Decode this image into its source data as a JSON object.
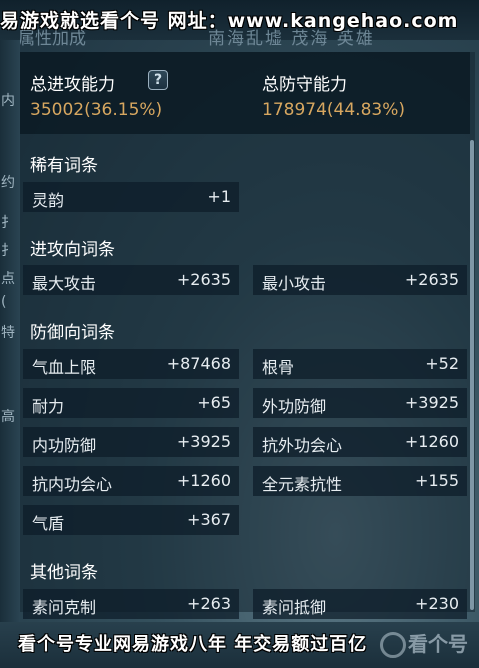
{
  "watermark_top": "易游戏就选看个号   网址：www.kangehao.com",
  "background_tabs": {
    "left": "属性加成",
    "right": "南海乱墟  茂海  英雄"
  },
  "left_strip_chars": [
    "内",
    "约",
    "扌",
    "扌",
    "点",
    "(",
    "特",
    "高"
  ],
  "summary": {
    "attack_label": "总进攻能力",
    "attack_value": "35002(36.15%)",
    "defense_label": "总防守能力",
    "defense_value": "178974(44.83%)",
    "help_icon_glyph": "?"
  },
  "sections": {
    "rare": {
      "title": "稀有词条",
      "items": [
        {
          "name": "灵韵",
          "value": "+1"
        }
      ]
    },
    "attack": {
      "title": "进攻向词条",
      "items": [
        {
          "name": "最大攻击",
          "value": "+2635"
        },
        {
          "name": "最小攻击",
          "value": "+2635"
        }
      ]
    },
    "defense": {
      "title": "防御向词条",
      "items": [
        {
          "name": "气血上限",
          "value": "+87468"
        },
        {
          "name": "根骨",
          "value": "+52"
        },
        {
          "name": "耐力",
          "value": "+65"
        },
        {
          "name": "外功防御",
          "value": "+3925"
        },
        {
          "name": "内功防御",
          "value": "+3925"
        },
        {
          "name": "抗外功会心",
          "value": "+1260"
        },
        {
          "name": "抗内功会心",
          "value": "+1260"
        },
        {
          "name": "全元素抗性",
          "value": "+155"
        },
        {
          "name": "气盾",
          "value": "+367"
        }
      ]
    },
    "other": {
      "title": "其他词条",
      "items": [
        {
          "name": "素问克制",
          "value": "+263"
        },
        {
          "name": "素问抵御",
          "value": "+230"
        }
      ]
    }
  },
  "bottom_banner": "看个号专业网易游戏八年  年交易额过百亿",
  "logo_text": "看个号",
  "colors": {
    "value_gold": "#d7a760",
    "text_white": "#ffffff"
  }
}
